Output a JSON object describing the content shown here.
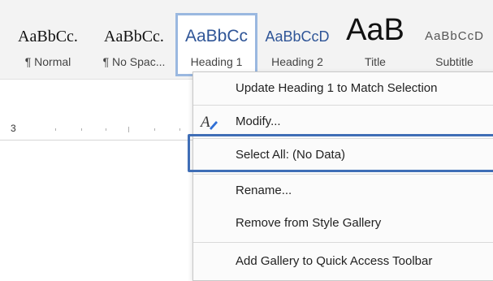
{
  "gallery": {
    "styles": [
      {
        "preview": "AaBbCc.",
        "caption": "¶ Normal"
      },
      {
        "preview": "AaBbCc.",
        "caption": "¶ No Spac..."
      },
      {
        "preview": "AaBbCc",
        "caption": "Heading 1"
      },
      {
        "preview": "AaBbCcD",
        "caption": "Heading 2"
      },
      {
        "preview": "AaB",
        "caption": "Title"
      },
      {
        "preview": "AaBbCcD",
        "caption": "Subtitle"
      }
    ]
  },
  "ruler": {
    "number": "3"
  },
  "context_menu": {
    "items": [
      {
        "label": "Update Heading 1 to Match Selection",
        "icon": null
      },
      {
        "label": "Modify...",
        "icon": "modify-pen-icon"
      },
      {
        "label": "Select All: (No Data)",
        "icon": null
      },
      {
        "label": "Rename...",
        "icon": null
      },
      {
        "label": "Remove from Style Gallery",
        "icon": null
      },
      {
        "label": "Add Gallery to Quick Access Toolbar",
        "icon": null
      }
    ]
  },
  "colors": {
    "heading_blue": "#2f5597",
    "highlight_border": "#3f6eb6",
    "selected_tile_border": "#9ab8e0"
  }
}
